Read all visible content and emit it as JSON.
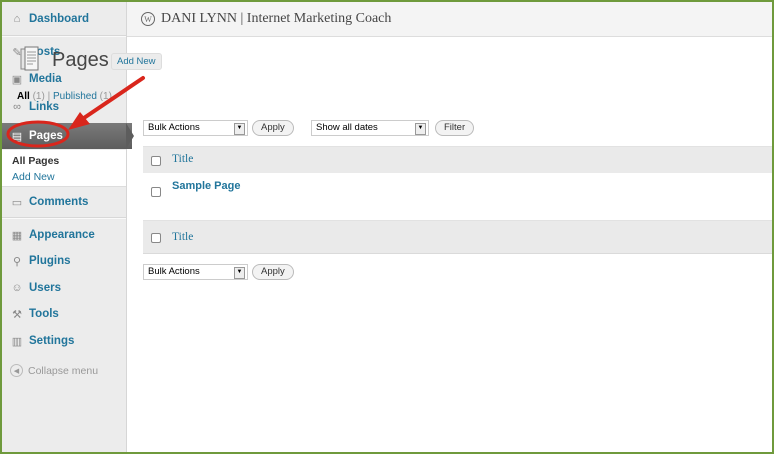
{
  "site": {
    "title": "DANI LYNN | Internet Marketing Coach"
  },
  "sidebar": {
    "items": [
      {
        "label": "Dashboard",
        "icon": "home-icon"
      },
      {
        "label": "Posts",
        "icon": "pushpin-icon"
      },
      {
        "label": "Media",
        "icon": "media-icon"
      },
      {
        "label": "Links",
        "icon": "link-icon"
      },
      {
        "label": "Pages",
        "icon": "pages-icon"
      },
      {
        "label": "Comments",
        "icon": "comment-icon"
      },
      {
        "label": "Appearance",
        "icon": "appearance-icon"
      },
      {
        "label": "Plugins",
        "icon": "plugin-icon"
      },
      {
        "label": "Users",
        "icon": "users-icon"
      },
      {
        "label": "Tools",
        "icon": "tools-icon"
      },
      {
        "label": "Settings",
        "icon": "settings-icon"
      }
    ],
    "pages_submenu": [
      "All Pages",
      "Add New"
    ],
    "collapse_label": "Collapse menu"
  },
  "page": {
    "heading": "Pages",
    "add_new": "Add New",
    "filters": {
      "all_label": "All",
      "all_count": "(1)",
      "separator": "|",
      "published_label": "Published",
      "published_count": "(1)"
    },
    "bulk_actions": "Bulk Actions",
    "apply": "Apply",
    "dates": "Show all dates",
    "filter": "Filter",
    "column_title": "Title",
    "rows": [
      "Sample Page"
    ]
  },
  "colors": {
    "link": "#21759b",
    "frame_border": "#6f9a3c",
    "annotation": "#d9261c",
    "active_menu": "#5d5d5d"
  }
}
